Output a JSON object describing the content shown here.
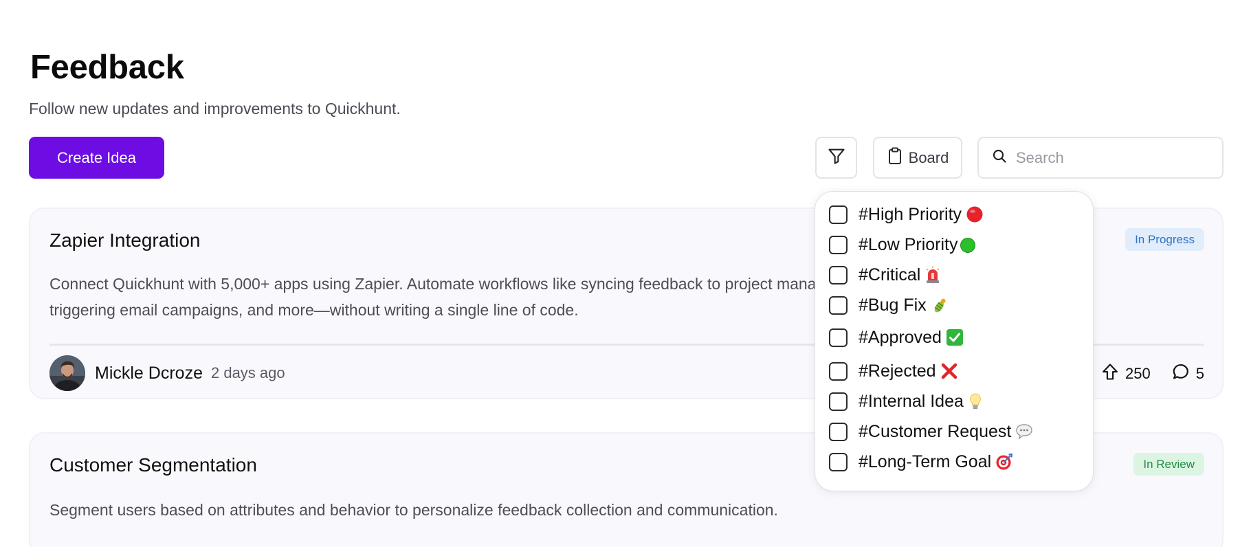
{
  "header": {
    "title": "Feedback",
    "subtitle": "Follow new updates and improvements to Quickhunt."
  },
  "toolbar": {
    "create_label": "Create Idea",
    "filter_icon": "filter-icon",
    "board_label": "Board",
    "board_icon": "clipboard-icon",
    "search_placeholder": "Search",
    "search_icon": "search-icon"
  },
  "colors": {
    "primary": "#6d0de3",
    "in_progress_bg": "#e1edfb",
    "in_progress_text": "#2e72c8",
    "in_review_bg": "#dcf5e2",
    "in_review_text": "#238a46"
  },
  "posts": [
    {
      "title": "Zapier Integration",
      "status": "In Progress",
      "description": "Connect Quickhunt with 5,000+ apps using Zapier. Automate workflows like syncing feedback to project management tools, sending data to CRMs, triggering email campaigns, and more—without writing a single line of code.",
      "author": "Mickle Dcroze",
      "time": "2 days ago",
      "upvotes": "250",
      "comments": "5"
    },
    {
      "title": "Customer Segmentation",
      "status": "In Review",
      "description": "Segment users based on attributes and behavior to personalize feedback collection and communication."
    }
  ],
  "filter_dropdown": {
    "items": [
      {
        "label": "#High Priority",
        "emoji": "🔴",
        "checked": false
      },
      {
        "label": "#Low Priority",
        "emoji": "🟢",
        "checked": false
      },
      {
        "label": "#Critical",
        "emoji": "🚨",
        "checked": false
      },
      {
        "label": "#Bug Fix",
        "emoji": "🐛",
        "checked": false
      },
      {
        "label": "#Approved",
        "emoji": "✅",
        "checked": false
      },
      {
        "label": "#Rejected",
        "emoji": "❌",
        "checked": false
      },
      {
        "label": "#Internal Idea",
        "emoji": "💡",
        "checked": false
      },
      {
        "label": "#Customer Request",
        "emoji": "💬",
        "checked": false
      },
      {
        "label": "#Long-Term Goal",
        "emoji": "🎯",
        "checked": false
      }
    ]
  }
}
